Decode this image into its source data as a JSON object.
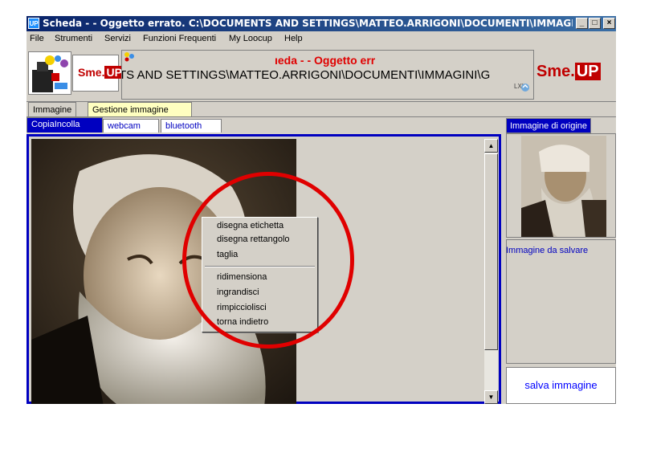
{
  "window": {
    "app_icon_text": "UP",
    "title": "Scheda - - Oggetto errato. C:\\DOCUMENTS AND SETTINGS\\MATTEO.ARRIGONI\\DOCUMENTI\\IMMAGINI\\GUIL...",
    "minimize_label": "_",
    "maximize_label": "□",
    "close_label": "×"
  },
  "menu": {
    "items": [
      "File",
      "Strumenti",
      "Servizi",
      "Funzioni Frequenti",
      "My Loocup",
      "Help"
    ]
  },
  "header": {
    "logo_left_text": "Sme.",
    "logo_left_up": "UP",
    "title_red": "ıeda - - Oggetto err",
    "path_text": "TS AND SETTINGS\\MATTEO.ARRIGONI\\DOCUMENTI\\IMMAGINI\\G",
    "small_code": "LXL",
    "logo_right_text": "Sme.",
    "logo_right_up": "UP"
  },
  "tabs_main": [
    "Immagine",
    "Gestione immagine"
  ],
  "tabs_sub": [
    "CopiaIncolla",
    "webcam",
    "bluetooth"
  ],
  "context_menu": {
    "group1": [
      "disegna etichetta",
      "disegna rettangolo",
      "taglia"
    ],
    "group2": [
      "ridimensiona",
      "ingrandisci",
      "rimpicciolisci",
      "torna indietro"
    ]
  },
  "side": {
    "origin_tab": "Immagine di origine",
    "save_label": "Immagine da salvare",
    "save_button": "salva immagine"
  },
  "colors": {
    "accent_blue": "#0000c0",
    "highlight_red": "#e00000",
    "tab_yellow": "#ffffc0"
  }
}
